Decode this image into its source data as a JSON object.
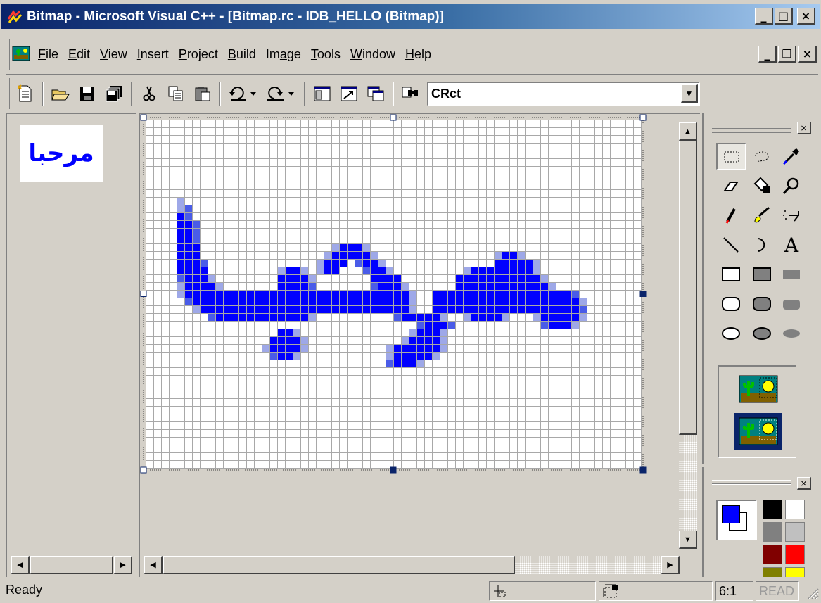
{
  "window": {
    "title": "Bitmap - Microsoft Visual C++ - [Bitmap.rc - IDB_HELLO (Bitmap)]",
    "minimize_glyph": "_",
    "maximize_glyph": "□",
    "close_glyph": "×",
    "doc_minimize_glyph": "_",
    "doc_restore_glyph": "❐",
    "doc_close_glyph": "×"
  },
  "menu": [
    {
      "key": "F",
      "rest": "ile"
    },
    {
      "key": "E",
      "rest": "dit"
    },
    {
      "key": "V",
      "rest": "iew"
    },
    {
      "key": "I",
      "rest": "nsert"
    },
    {
      "key": "P",
      "rest": "roject"
    },
    {
      "key": "B",
      "rest": "uild"
    },
    {
      "pre": "Im",
      "key": "a",
      "rest": "ge"
    },
    {
      "key": "T",
      "rest": "ools"
    },
    {
      "key": "W",
      "rest": "indow"
    },
    {
      "key": "H",
      "rest": "elp"
    }
  ],
  "toolbar": {
    "icons": [
      "new-text-file-icon",
      "open-icon",
      "save-icon",
      "save-all-icon",
      "cut-icon",
      "copy-icon",
      "paste-icon",
      "undo-icon",
      "redo-icon",
      "workspace-icon",
      "output-icon",
      "window-list-icon",
      "find-in-files-icon"
    ],
    "find_combo_value": "CRct"
  },
  "preview": {
    "text": "مرحبا",
    "color": "#0000ff"
  },
  "toolbox": {
    "tools": [
      "select-rect-icon",
      "free-select-icon",
      "color-picker-icon",
      "eraser-icon",
      "fill-icon",
      "magnifier-icon",
      "pencil-icon",
      "brush-icon",
      "airbrush-icon",
      "line-icon",
      "curve-icon",
      "text-tool-icon",
      "rect-outline-icon",
      "rect-filled-outline-icon",
      "rect-filled-icon",
      "roundrect-outline-icon",
      "roundrect-filled-outline-icon",
      "roundrect-filled-icon",
      "ellipse-outline-icon",
      "ellipse-filled-outline-icon",
      "ellipse-filled-icon"
    ],
    "text_tool_glyph": "A",
    "selected_tool": "select-rect-icon"
  },
  "palette": {
    "foreground": "#0000ff",
    "background": "#ffffff",
    "colors": [
      "#000000",
      "#ffffff",
      "#808080",
      "#c0c0c0",
      "#800000",
      "#ff0000",
      "#808000",
      "#ffff00"
    ]
  },
  "canvas": {
    "bitmap_size": [
      64,
      45
    ],
    "zoom_label": "6:1",
    "ink_color": "#0000ff",
    "aa_color": "#9ea8e8",
    "background": "#ffffff",
    "rows": [
      "................................................................",
      "................................................................",
      "................................................................",
      "................................................................",
      "................................................................",
      "................................................................",
      "................................................................",
      "................................................................",
      "................................................................",
      "................................................................",
      "....a...........................................................",
      "....ab..........................................................",
      "....Bb..........................................................",
      "....BBb.........................................................",
      "....BBb.........................................................",
      "....BBb..........................................................",
      "....BBB.................aBBBa...................................",
      "....BBB................aBBBBBa...............aBBa................",
      "....BBBb..............aBBB.bBBa..............BBBBBa.............",
      "....BBBB.........aBBa.aBB...bBBa.........aBBBBBBBBa.............",
      "....bBBBa........BBBBa.......BBBB.......BBBBBBBBBBBa............",
      "....aBBBBa.......BBBBb.......bBBBa......BBBBBBBBBBBBa...........",
      "....aBBBBBBBBBBBBBBBBBBBBBBBBBBBBBa..BBBBBBBBBBBBBBBBBBb........",
      ".....bBBBBBBBBBBBBBBBBBBBBBBBBBBBBa..BBBBBBBBBBBBBBBBBBBa........",
      "......aBBBBBBBBBBBBBBBBBBBBBBBBBBBa..BBBBBBBBBBBBBBBBBBBb........",
      "........bBBBBBBBBBBBBa..........bBBBBBa..aBBBBa...aBBBBBa........",
      "...................................bBBBb...........bBBBa.........",
      ".................BBa..............aBBBa.........................",
      "................BBBBa............aBBBBa.........................",
      "...............aBBBBa..........aBBBBBBa.........................",
      "................bBBa...........aBBBBBa..........................",
      "...............................bBBBa............................",
      "................................................................",
      "................................................................",
      "................................................................",
      "................................................................",
      "................................................................",
      "................................................................",
      "................................................................",
      "................................................................",
      "................................................................",
      "................................................................",
      "................................................................",
      "................................................................",
      "................................................................"
    ]
  },
  "status": {
    "text": "Ready",
    "zoom": "6:1",
    "read": "READ"
  }
}
